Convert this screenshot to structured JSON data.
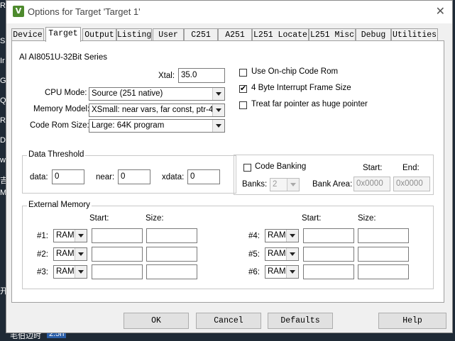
{
  "background": {
    "left_fragments": [
      "R",
      "S",
      "Ir",
      "G",
      "Q",
      "R",
      "D",
      "w",
      "吉",
      "M",
      "开",
      "毛伯边时",
      "2.5h"
    ]
  },
  "window": {
    "title": "Options for Target 'Target 1'",
    "icon_letter": "V",
    "close_glyph": "✕"
  },
  "tabs": [
    {
      "label": "Device"
    },
    {
      "label": "Target"
    },
    {
      "label": "Output"
    },
    {
      "label": "Listing"
    },
    {
      "label": "User"
    },
    {
      "label": "C251"
    },
    {
      "label": "A251"
    },
    {
      "label": "L251 Locate"
    },
    {
      "label": "L251 Misc"
    },
    {
      "label": "Debug"
    },
    {
      "label": "Utilities"
    }
  ],
  "target": {
    "device_name": "AI AI8051U-32Bit Series",
    "xtal_label": "Xtal:",
    "xtal_value": "35.0",
    "cpu_mode_label": "CPU Mode:",
    "cpu_mode_value": "Source (251 native)",
    "memory_model_label": "Memory Model:",
    "memory_model_value": "XSmall: near vars, far const, ptr-4",
    "code_rom_label": "Code Rom Size:",
    "code_rom_value": "Large: 64K program",
    "use_onchip_rom": {
      "label": "Use On-chip Code Rom",
      "checked": false
    },
    "four_byte_interrupt": {
      "label": "4 Byte Interrupt Frame Size",
      "checked": true
    },
    "far_pointer_huge": {
      "label": "Treat far pointer as huge pointer",
      "checked": false
    }
  },
  "data_threshold": {
    "title": "Data Threshold",
    "data_label": "data:",
    "data_value": "0",
    "near_label": "near:",
    "near_value": "0",
    "xdata_label": "xdata:",
    "xdata_value": "0"
  },
  "code_banking": {
    "label": "Code Banking",
    "checked": false,
    "start_label": "Start:",
    "end_label": "End:",
    "banks_label": "Banks:",
    "banks_value": "2",
    "bank_area_label": "Bank Area:",
    "bank_start": "0x0000",
    "bank_end": "0x0000"
  },
  "external_memory": {
    "title": "External Memory",
    "start_label": "Start:",
    "size_label": "Size:",
    "rows": [
      {
        "label": "#1:",
        "type": "RAM",
        "start": "",
        "size": ""
      },
      {
        "label": "#2:",
        "type": "RAM",
        "start": "",
        "size": ""
      },
      {
        "label": "#3:",
        "type": "RAM",
        "start": "",
        "size": ""
      },
      {
        "label": "#4:",
        "type": "RAM",
        "start": "",
        "size": ""
      },
      {
        "label": "#5:",
        "type": "RAM",
        "start": "",
        "size": ""
      },
      {
        "label": "#6:",
        "type": "RAM",
        "start": "",
        "size": ""
      }
    ]
  },
  "buttons": {
    "ok": "OK",
    "cancel": "Cancel",
    "defaults": "Defaults",
    "help": "Help"
  }
}
